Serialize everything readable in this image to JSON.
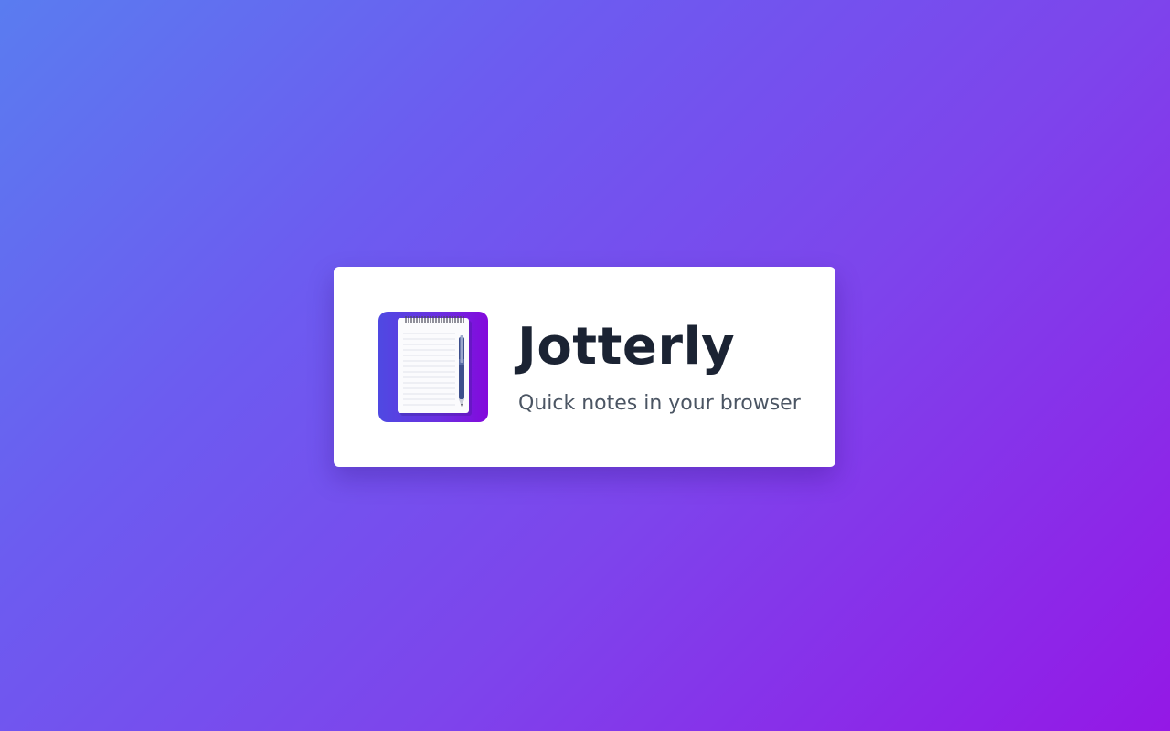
{
  "background": {
    "gradient_start": "#5a7cf0",
    "gradient_end": "#9418e6"
  },
  "card": {
    "icon": "notepad-with-pen-icon",
    "icon_colors": {
      "gradient_start": "#4f49e2",
      "gradient_end": "#8409dc"
    },
    "title": "Jotterly",
    "subtitle": "Quick notes in your browser"
  }
}
